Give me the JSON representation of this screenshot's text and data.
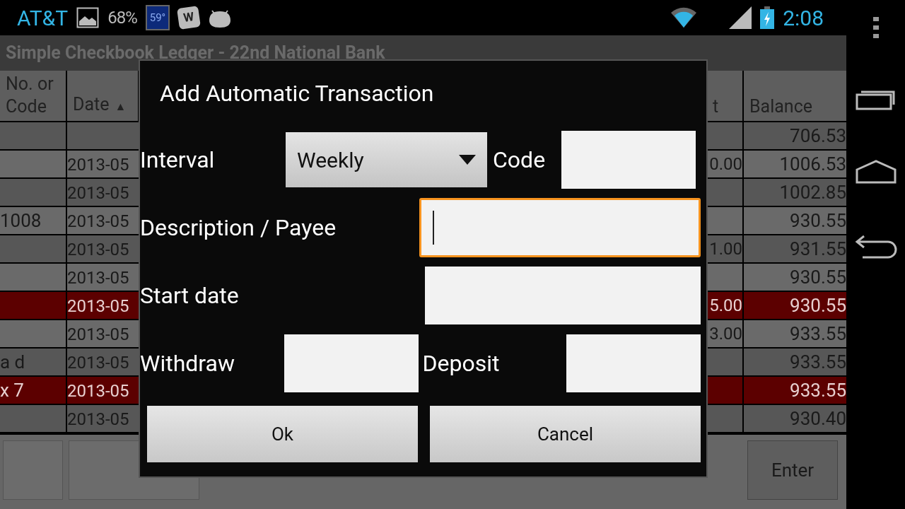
{
  "status_bar": {
    "carrier": "AT&T",
    "battery_notice": "68%",
    "weather": "59°",
    "app_badge": "W",
    "time": "2:08"
  },
  "app": {
    "title": "Simple Checkbook Ledger - 22nd National Bank",
    "columns": [
      {
        "label": "No. or Code"
      },
      {
        "label": "Date",
        "sort_arrow": "▲"
      },
      {
        "label": "t"
      },
      {
        "label": "Balance"
      }
    ],
    "rows": [
      {
        "code": "",
        "date": "",
        "deposit": "",
        "balance": "706.53",
        "highlighted": false
      },
      {
        "code": "",
        "date": "2013-05",
        "deposit": "0.00",
        "balance": "1006.53",
        "highlighted": false
      },
      {
        "code": "",
        "date": "2013-05",
        "deposit": "",
        "balance": "1002.85",
        "highlighted": false
      },
      {
        "code": "1008",
        "date": "2013-05",
        "deposit": "",
        "balance": "930.55",
        "highlighted": false
      },
      {
        "code": "",
        "date": "2013-05",
        "deposit": "1.00",
        "balance": "931.55",
        "highlighted": false
      },
      {
        "code": "",
        "date": "2013-05",
        "deposit": "",
        "balance": "930.55",
        "highlighted": false
      },
      {
        "code": "",
        "date": "2013-05",
        "deposit": "5.00",
        "balance": "930.55",
        "highlighted": true
      },
      {
        "code": "",
        "date": "2013-05",
        "deposit": "3.00",
        "balance": "933.55",
        "highlighted": false
      },
      {
        "code": "a d",
        "date": "2013-05",
        "deposit": "",
        "balance": "933.55",
        "highlighted": false
      },
      {
        "code": "x 7",
        "date": "2013-05",
        "deposit": "",
        "balance": "933.55",
        "highlighted": true
      },
      {
        "code": "",
        "date": "2013-05",
        "deposit": "",
        "balance": "930.40",
        "highlighted": false
      }
    ],
    "enter_button": "Enter"
  },
  "dialog": {
    "title": "Add Automatic Transaction",
    "interval": {
      "label": "Interval",
      "value": "Weekly"
    },
    "code": {
      "label": "Code",
      "focused": false
    },
    "description": {
      "label": "Description / Payee",
      "focused": true
    },
    "start_date": {
      "label": "Start date",
      "focused": false
    },
    "withdraw": {
      "label": "Withdraw",
      "focused": false
    },
    "deposit": {
      "label": "Deposit",
      "focused": false
    },
    "buttons": [
      "Ok",
      "Cancel"
    ]
  }
}
